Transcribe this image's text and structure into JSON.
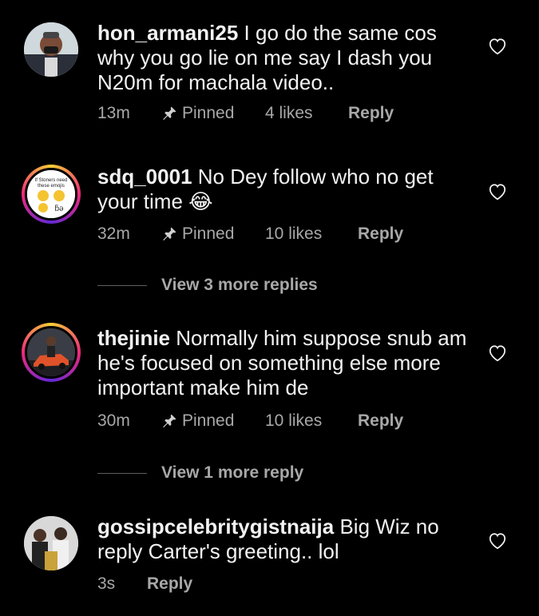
{
  "comments": [
    {
      "username": "hon_armani25",
      "text": "I go do the same cos why you go lie on me say I dash you N20m for machala video..",
      "time": "13m",
      "pinned": "Pinned",
      "likes": "4 likes",
      "reply": "Reply",
      "avatar_icon": "man-with-mask-avatar"
    },
    {
      "username": "sdq_0001",
      "text": "No Dey follow who no get your time 😂",
      "time": "32m",
      "pinned": "Pinned",
      "likes": "10 likes",
      "reply": "Reply",
      "avatar_text": "If Stoners need these emojis",
      "view_more": "View 3 more replies"
    },
    {
      "username": "thejinie",
      "text": "Normally him suppose snub am he's focused on something else more important make him de",
      "time": "30m",
      "pinned": "Pinned",
      "likes": "10 likes",
      "reply": "Reply",
      "avatar_icon": "car-photo-avatar",
      "view_more": "View 1 more reply"
    },
    {
      "username": "gossipcelebritygistnaija",
      "text": "Big Wiz no reply Carter's greeting.. lol",
      "time": "3s",
      "reply": "Reply",
      "avatar_icon": "group-photo-avatar"
    }
  ],
  "colors": {
    "background": "#000000",
    "text": "#f2f2f2",
    "muted": "#a8a8a8"
  },
  "icons": {
    "pin": "pin-icon",
    "heart": "heart-outline-icon"
  }
}
